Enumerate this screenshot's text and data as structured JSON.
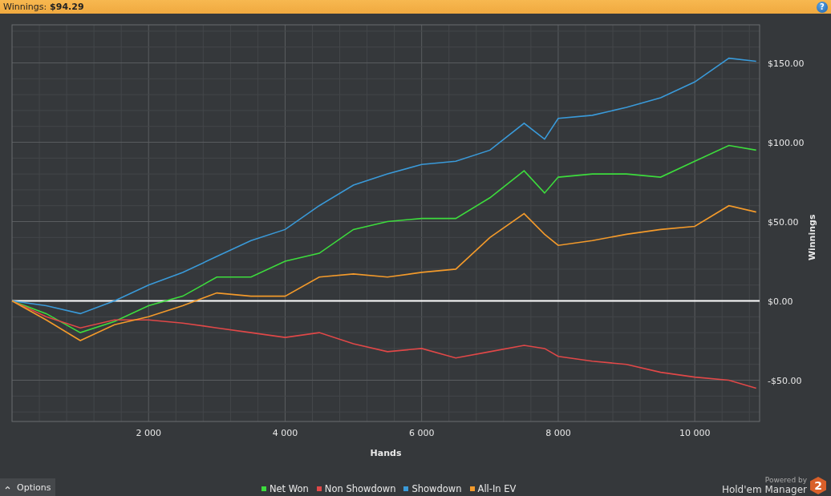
{
  "header": {
    "label": "Winnings:",
    "value": "$94.29",
    "help_button": "?"
  },
  "chart": {
    "chart_data": {
      "type": "line",
      "xlabel": "Hands",
      "ylabel": "Winnings",
      "x": [
        0,
        500,
        1000,
        1500,
        2000,
        2500,
        3000,
        3500,
        4000,
        4500,
        5000,
        5500,
        6000,
        6500,
        7000,
        7500,
        7800,
        8000,
        8500,
        9000,
        9500,
        10000,
        10500,
        10900
      ],
      "series": [
        {
          "name": "Net Won",
          "color": "#3ddc3d",
          "values": [
            0,
            -8,
            -20,
            -13,
            -3,
            3,
            15,
            15,
            25,
            30,
            45,
            50,
            52,
            52,
            65,
            82,
            68,
            78,
            80,
            80,
            78,
            88,
            98,
            95
          ]
        },
        {
          "name": "Non Showdown",
          "color": "#e04848",
          "values": [
            0,
            -10,
            -17,
            -12,
            -12,
            -14,
            -17,
            -20,
            -23,
            -20,
            -27,
            -32,
            -30,
            -36,
            -32,
            -28,
            -30,
            -35,
            -38,
            -40,
            -45,
            -48,
            -50,
            -55
          ]
        },
        {
          "name": "Showdown",
          "color": "#3a9ad9",
          "values": [
            0,
            -3,
            -8,
            0,
            10,
            18,
            28,
            38,
            45,
            60,
            73,
            80,
            86,
            88,
            95,
            112,
            102,
            115,
            117,
            122,
            128,
            138,
            153,
            151
          ]
        },
        {
          "name": "All-In EV",
          "color": "#f39a2b",
          "values": [
            0,
            -12,
            -25,
            -15,
            -10,
            -3,
            5,
            3,
            3,
            15,
            17,
            15,
            18,
            20,
            40,
            55,
            42,
            35,
            38,
            42,
            45,
            47,
            60,
            56
          ]
        }
      ],
      "grid": true,
      "xlim": [
        0,
        10950
      ],
      "ylim": [
        -76,
        174
      ],
      "xticks": [
        {
          "value": 2000,
          "label": "2 000"
        },
        {
          "value": 4000,
          "label": "4 000"
        },
        {
          "value": 6000,
          "label": "6 000"
        },
        {
          "value": 8000,
          "label": "8 000"
        },
        {
          "value": 10000,
          "label": "10 000"
        }
      ],
      "yticks": [
        {
          "value": -50,
          "label": "-$50.00"
        },
        {
          "value": 0,
          "label": "$0.00"
        },
        {
          "value": 50,
          "label": "$50.00"
        },
        {
          "value": 100,
          "label": "$100.00"
        },
        {
          "value": 150,
          "label": "$150.00"
        }
      ]
    }
  },
  "footer": {
    "options_button": "Options",
    "powered_by": "Powered by",
    "product": "Hold'em Manager",
    "logo_badge": "2"
  }
}
